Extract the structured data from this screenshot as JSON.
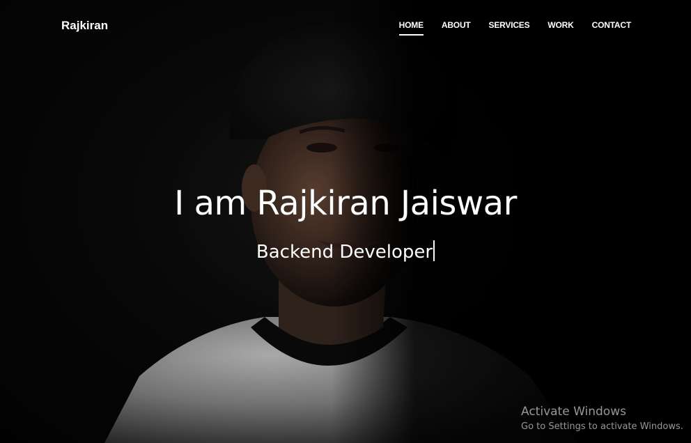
{
  "navbar": {
    "brand": "Rajkiran",
    "links": [
      {
        "label": "HOME",
        "active": true
      },
      {
        "label": "ABOUT",
        "active": false
      },
      {
        "label": "SERVICES",
        "active": false
      },
      {
        "label": "WORK",
        "active": false
      },
      {
        "label": "CONTACT",
        "active": false
      }
    ]
  },
  "hero": {
    "headline": "I am Rajkiran Jaiswar",
    "subtitle": "Backend Developer",
    "background_image": "portrait-photo"
  },
  "watermark": {
    "title": "Activate Windows",
    "subtitle": "Go to Settings to activate Windows."
  },
  "colors": {
    "background": "#050505",
    "text": "#ffffff",
    "watermark": "#c8c8c8"
  }
}
